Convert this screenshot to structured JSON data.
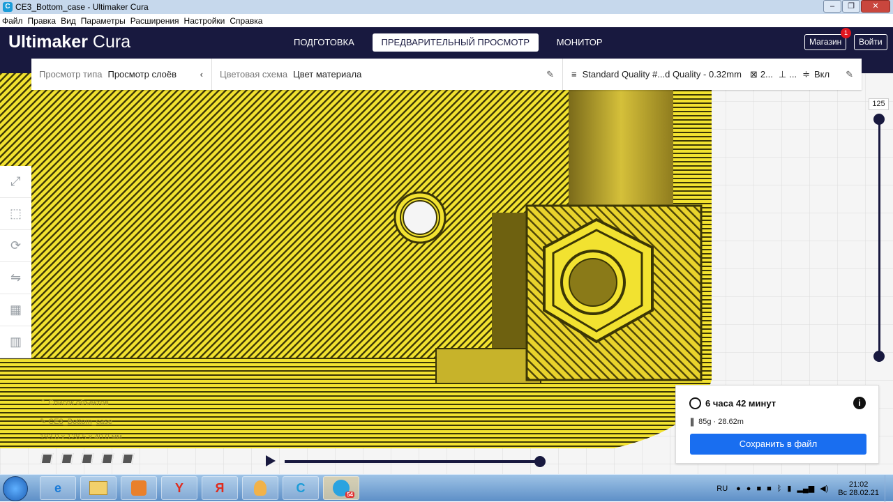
{
  "window": {
    "title": "CE3_Bottom_case - Ultimaker Cura",
    "app_icon_letter": "C"
  },
  "menu": [
    "Файл",
    "Правка",
    "Вид",
    "Параметры",
    "Расширения",
    "Настройки",
    "Справка"
  ],
  "header": {
    "logo_bold": "Ultimaker",
    "logo_light": "Cura",
    "stages": [
      "ПОДГОТОВКА",
      "ПРЕДВАРИТЕЛЬНЫЙ ПРОСМОТР",
      "МОНИТОР"
    ],
    "marketplace": "Магазин",
    "marketplace_badge": "1",
    "signin": "Войти"
  },
  "view_toolbar": {
    "view_type_label": "Просмотр типа",
    "view_type_value": "Просмотр слоёв",
    "color_scheme_label": "Цветовая схема",
    "color_scheme_value": "Цвет материала",
    "profile": "Standard Quality #...d Quality - 0.32mm",
    "infill": "2...",
    "support": "...",
    "adhesion": "Вкл"
  },
  "layer_slider": {
    "current_layer": "125",
    "min_layer": 1,
    "max_layer": 125
  },
  "print_info": {
    "time": "6 часа 42 минут",
    "material": "85g · 28.62m",
    "save_label": "Сохранить в файл"
  },
  "object_info": {
    "list_label": "Список объектов",
    "object_name": "CE3_Bottom_case",
    "dimensions": "193.0 x 128.5 x 40.0 мм"
  },
  "colors": {
    "accent": "#196ef0",
    "header_bg": "#18193f",
    "model_yellow": "#f2e230"
  },
  "taskbar": {
    "apps": [
      "e",
      "",
      "",
      "Y",
      "Я",
      "",
      "C",
      ""
    ],
    "telegram_badge": "54",
    "lang": "RU",
    "time": "21:02",
    "date": "Вс 28.02.21"
  }
}
